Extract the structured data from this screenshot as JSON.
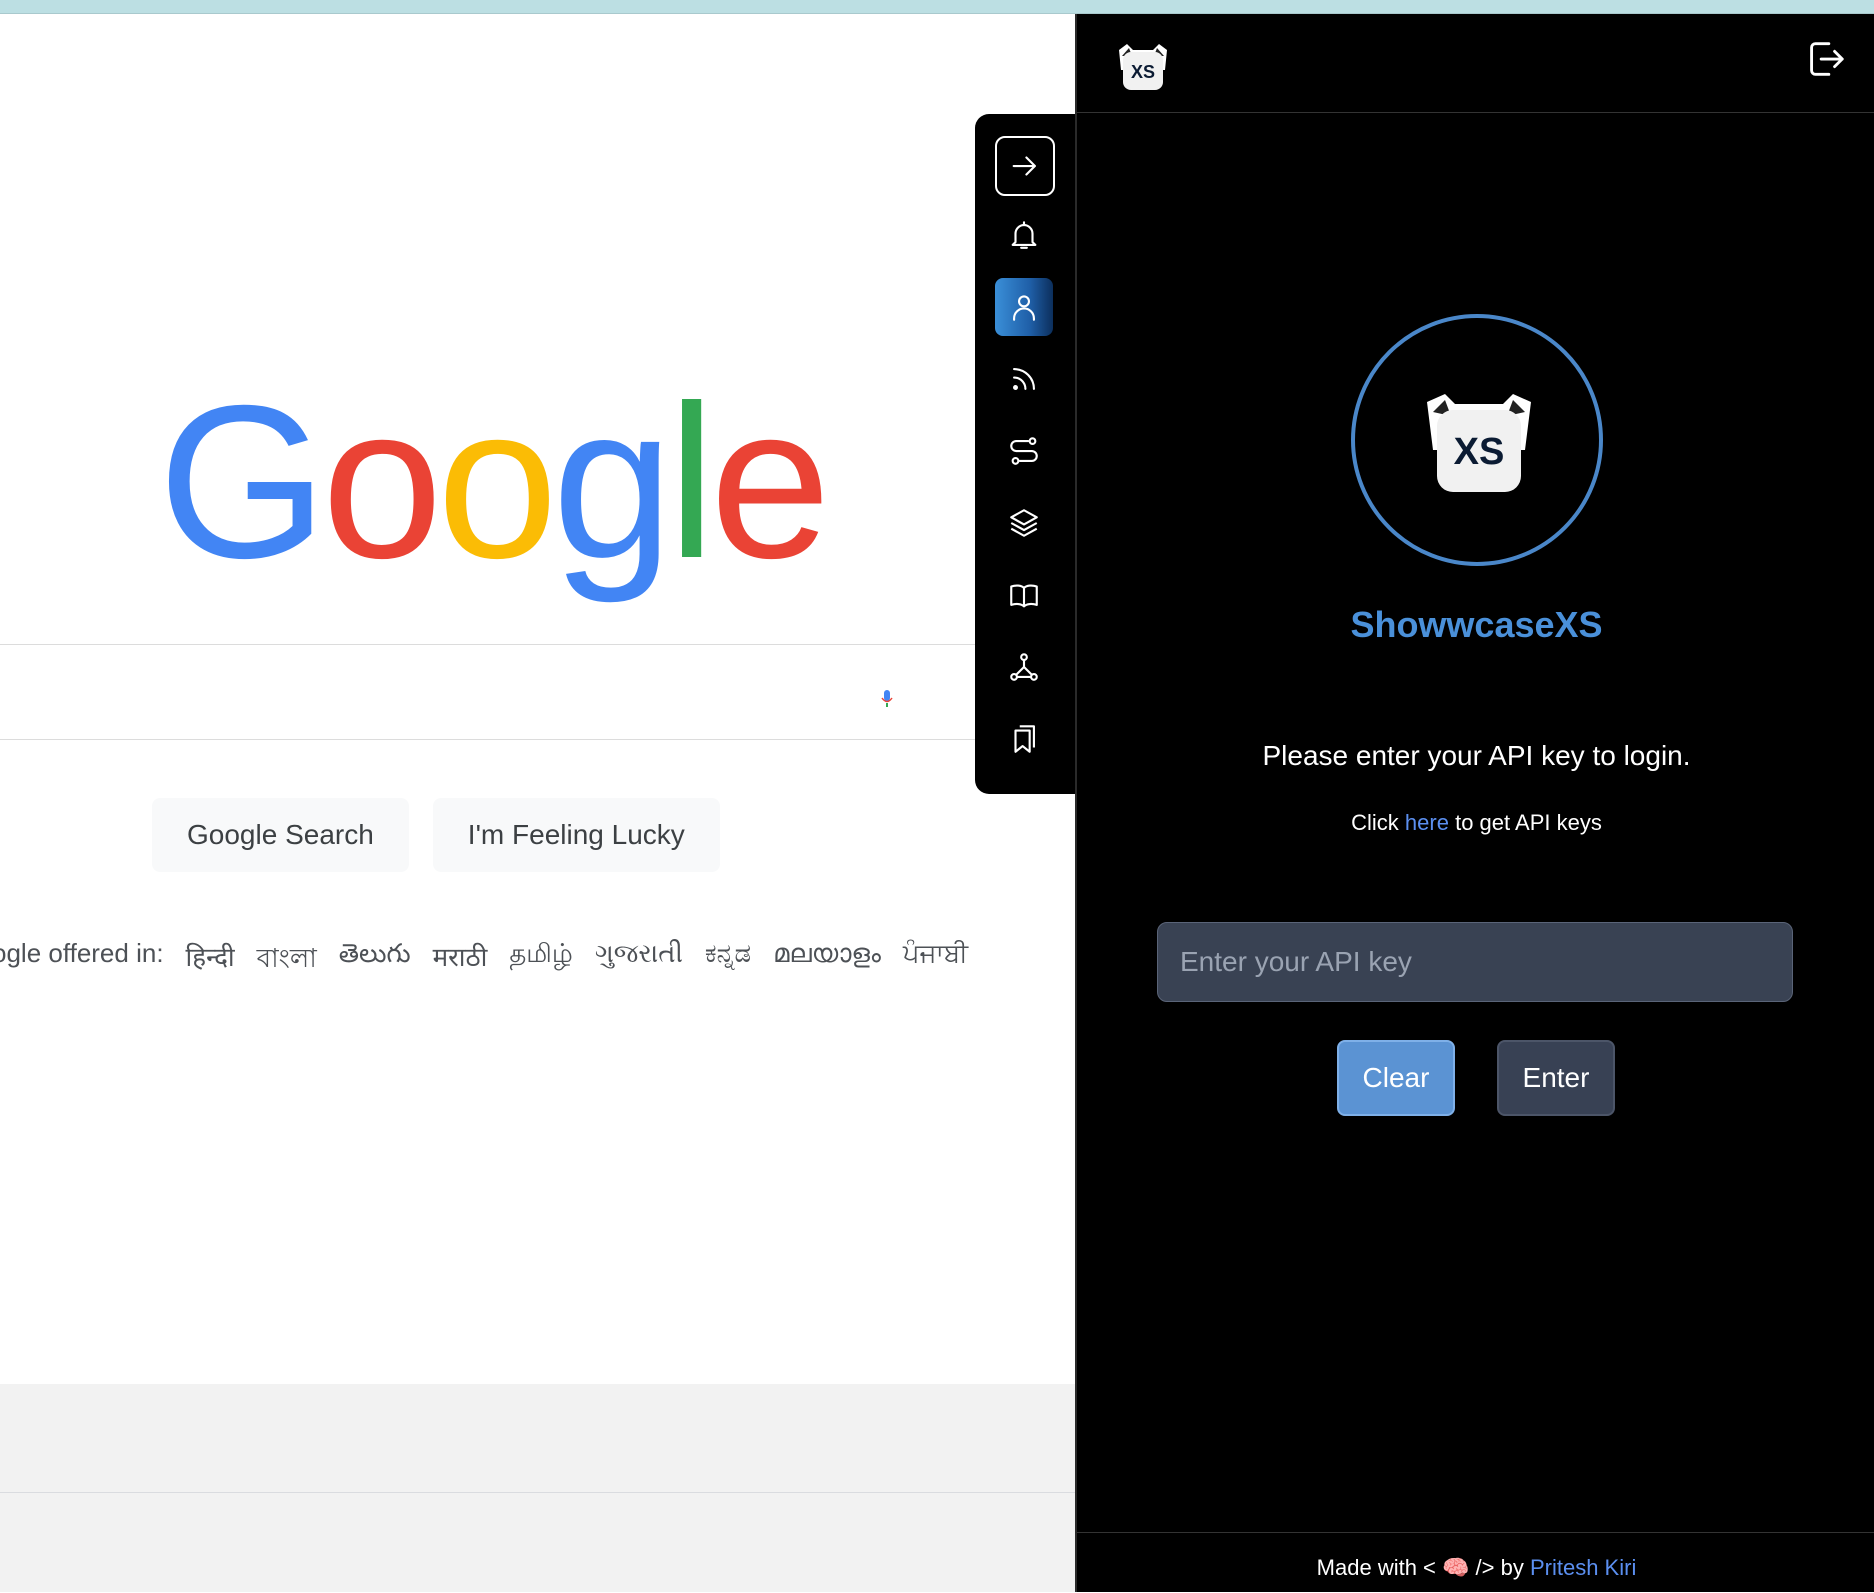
{
  "google": {
    "logo_letters": [
      "G",
      "o",
      "o",
      "g",
      "l",
      "e"
    ],
    "search_button": "Google Search",
    "lucky_button": "I'm Feeling Lucky",
    "offered_in_label": "ogle offered in:",
    "languages": [
      "हिन्दी",
      "বাংলা",
      "తెలుగు",
      "मराठी",
      "தமிழ்",
      "ગુજરાતી",
      "ಕನ್ನಡ",
      "മലയാളം",
      "ਪੰਜਾਬੀ"
    ]
  },
  "toolbar": {
    "items": [
      {
        "name": "arrow-right-icon"
      },
      {
        "name": "bell-icon"
      },
      {
        "name": "user-icon",
        "active": true
      },
      {
        "name": "feed-icon"
      },
      {
        "name": "route-icon"
      },
      {
        "name": "layers-icon"
      },
      {
        "name": "book-icon"
      },
      {
        "name": "network-icon"
      },
      {
        "name": "bookmarks-icon"
      }
    ]
  },
  "panel": {
    "logo_text": "XS",
    "brand": "ShowwcaseXS",
    "prompt": "Please enter your API key to login.",
    "api_hint_prefix": "Click ",
    "api_hint_link": "here",
    "api_hint_suffix": " to get API keys",
    "input_placeholder": "Enter your API key",
    "clear_label": "Clear",
    "enter_label": "Enter",
    "footer_prefix": "Made with < ",
    "footer_emoji": "🧠",
    "footer_middle": " /> by ",
    "footer_author": "Pritesh Kiri"
  },
  "colors": {
    "accent": "#4a90d9",
    "link": "#5b8ff0",
    "clear_bg": "#5b93d3",
    "enter_bg": "#384154",
    "panel_bg": "#000000",
    "google_blue": "#4285F4",
    "google_red": "#EA4335",
    "google_yellow": "#FBBC05",
    "google_green": "#34A853"
  }
}
